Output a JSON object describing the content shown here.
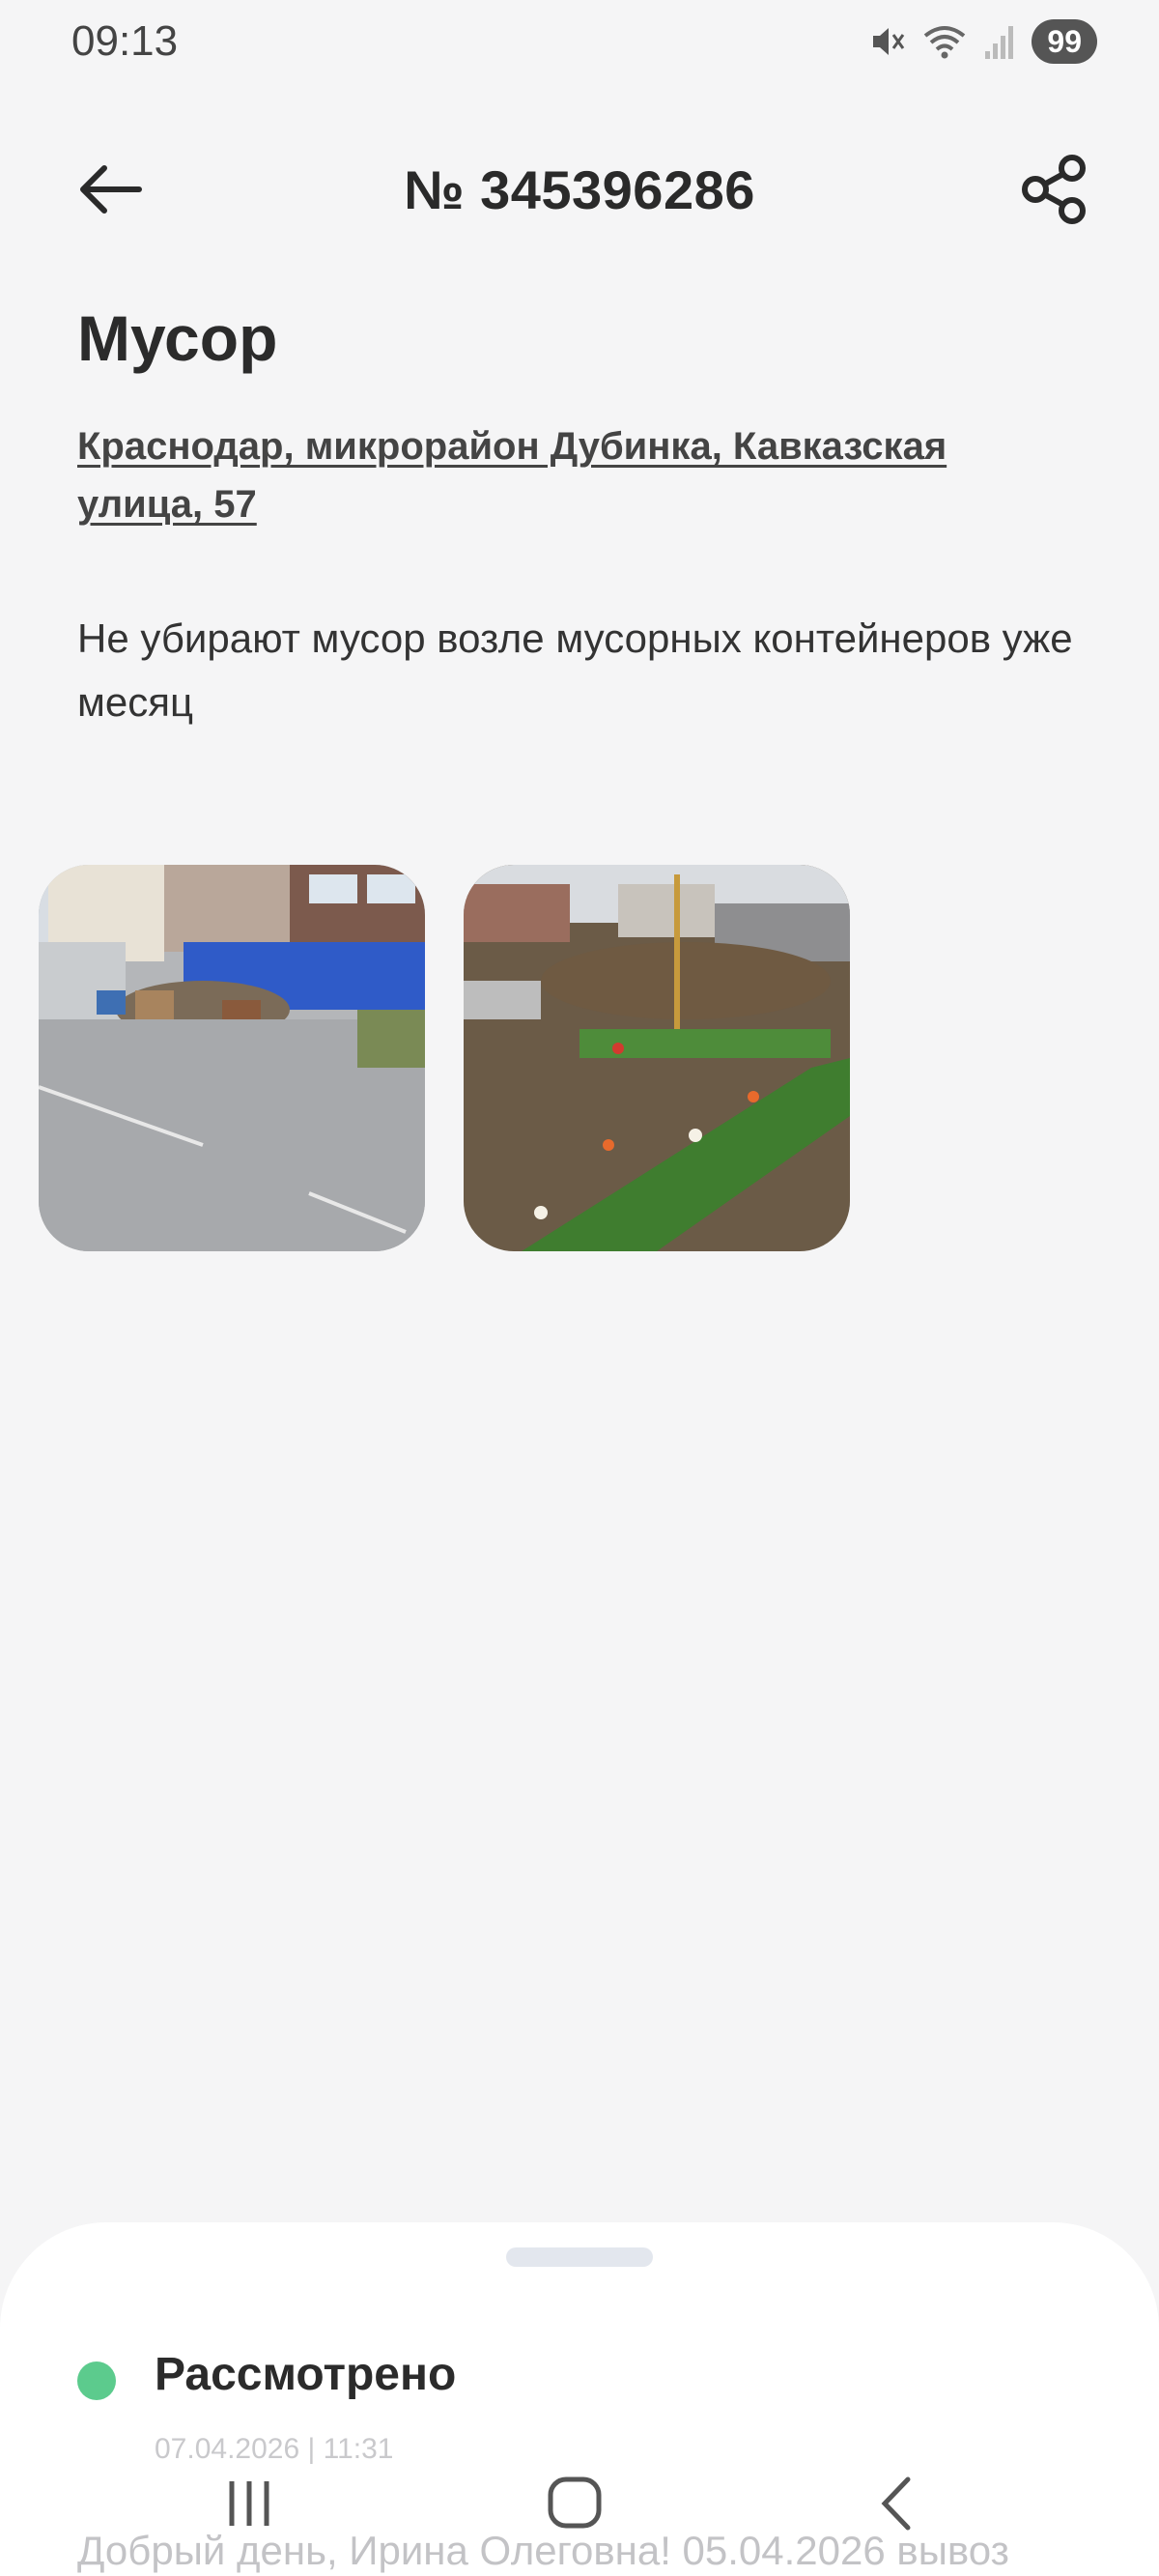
{
  "status_bar": {
    "time": "09:13",
    "battery": "99",
    "icons": [
      "mute-icon",
      "wifi-icon",
      "signal-icon",
      "battery-icon"
    ]
  },
  "header": {
    "title": "№ 345396286",
    "back_icon": "arrow-left-icon",
    "share_icon": "share-icon"
  },
  "issue": {
    "category": "Мусор",
    "address": "Краснодар, микрорайон Дубинка, Кавказская улица, 57",
    "description": "Не убирают мусор возле мусорных контейнеров уже месяц"
  },
  "photos": [
    "photo-garbage-street",
    "photo-garbage-flowerbed"
  ],
  "status_sheet": {
    "status": "Рассмотрено",
    "status_color": "#5ccb8d",
    "date": "07.04.2026 | 11:31",
    "response_preview": "Добрый день, Ирина Олеговна! 05.04.2026 вывоз"
  },
  "nav_bar": {
    "icons": [
      "recent-apps-icon",
      "home-icon",
      "back-icon"
    ]
  }
}
